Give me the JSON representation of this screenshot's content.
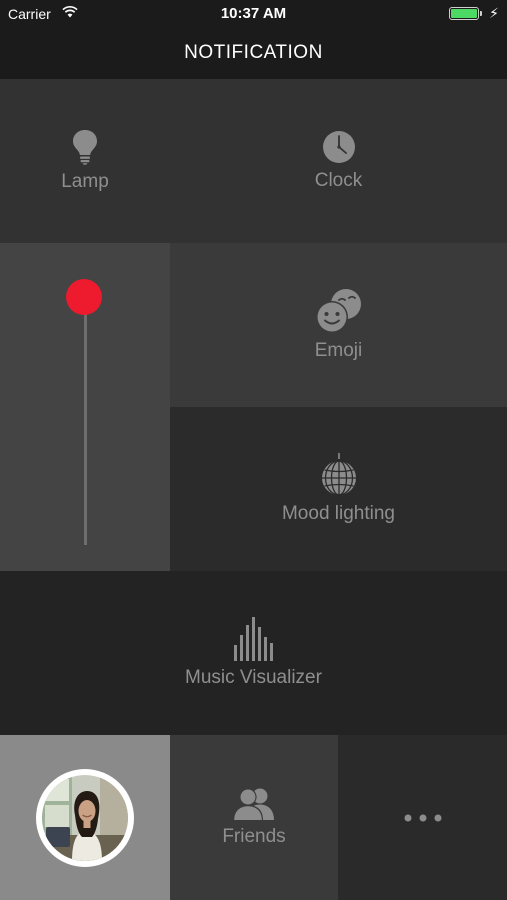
{
  "status_bar": {
    "carrier": "Carrier",
    "time": "10:37 AM"
  },
  "nav": {
    "title": "NOTIFICATION"
  },
  "tiles": {
    "lamp": {
      "label": "Lamp",
      "icon": "lightbulb-icon"
    },
    "clock": {
      "label": "Clock",
      "icon": "clock-icon"
    },
    "emoji": {
      "label": "Emoji",
      "icon": "emoji-faces-icon"
    },
    "mood": {
      "label": "Mood lighting",
      "icon": "disco-ball-icon"
    },
    "music": {
      "label": "Music Visualizer",
      "icon": "equalizer-icon"
    },
    "friends": {
      "label": "Friends",
      "icon": "friends-icon"
    },
    "more": {
      "icon": "more-dots-icon"
    }
  },
  "brightness_slider": {
    "level": 1.0,
    "knob_color": "#ee1a2e"
  },
  "colors": {
    "accent": "#ee1a2e",
    "label": "#8f8f8f",
    "battery": "#4cd964"
  }
}
